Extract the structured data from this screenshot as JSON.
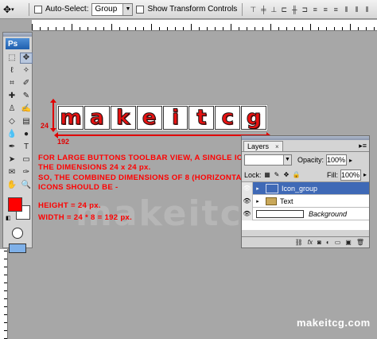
{
  "options_bar": {
    "auto_select_label": "Auto-Select:",
    "auto_select_value": "Group",
    "show_transform_label": "Show Transform Controls"
  },
  "toolbox": {
    "logo": "Ps",
    "foreground_color": "#ff0000",
    "background_color": "#ffffff"
  },
  "canvas": {
    "logo_letters": [
      "m",
      "a",
      "k",
      "e",
      "i",
      "t",
      "c",
      "g"
    ],
    "height_dimension": "24",
    "width_dimension": "192",
    "note_lines": [
      "FOR LARGE BUTTONS TOOLBAR VIEW, A SINGLE ICON USES",
      "THE DIMENSIONS  24 x 24 px.",
      "SO, THE COMBINED DIMENSIONS OF 8 (HORIZONTALLY ARRANGED)",
      "ICONS SHOULD BE -",
      "HEIGHT = 24 px.",
      "WIDTH = 24 * 8 = 192 px."
    ],
    "watermark": "makeitcg",
    "credit": "makeitcg.com"
  },
  "layers_panel": {
    "tab_label": "Layers",
    "tab_close": "×",
    "opacity_label": "Opacity:",
    "opacity_value": "100%",
    "lock_label": "Lock:",
    "fill_label": "Fill:",
    "fill_value": "100%",
    "layers": [
      {
        "name": "Icon_group",
        "selected": true
      },
      {
        "name": "Text",
        "selected": false
      },
      {
        "name": "Background",
        "selected": false
      }
    ],
    "footer_icons": [
      "link-icon",
      "fx-icon",
      "mask-icon",
      "adjustment-icon",
      "folder-icon",
      "new-layer-icon",
      "trash-icon"
    ]
  },
  "colors": {
    "accent_red": "#ff0000",
    "selection_blue": "#3f69b6"
  }
}
